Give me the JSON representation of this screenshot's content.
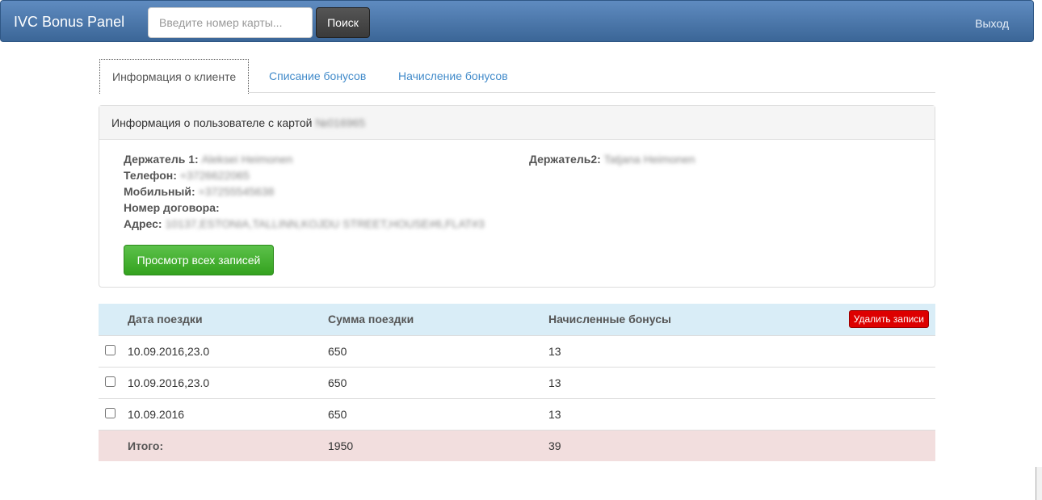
{
  "navbar": {
    "brand": "IVC Bonus Panel",
    "search_placeholder": "Введите номер карты...",
    "search_button": "Поиск",
    "logout": "Выход"
  },
  "tabs": [
    {
      "label": "Информация о клиенте",
      "active": true
    },
    {
      "label": "Списание бонусов"
    },
    {
      "label": "Начисление бонусов"
    }
  ],
  "panel": {
    "heading": "Информация о пользователе с картой",
    "card_number": "№016965",
    "holder1_label": "Держатель 1:",
    "holder1": "Aleksei Heimonen",
    "phone_label": "Телефон:",
    "phone": "+3726622065",
    "mobile_label": "Мобильный:",
    "mobile": "+37255545638",
    "contract_label": "Номер договора:",
    "address_label": "Адрес:",
    "address": "10137,ESTONIA,TALLINN,KOJDU STREET,HOUSE#6,FLAT#3",
    "holder2_label": "Держатель2:",
    "holder2": "Tatjana Heimonen",
    "view_all_button": "Просмотр всех записей"
  },
  "table": {
    "headers": [
      "Дата поездки",
      "Сумма поездки",
      "Начисленные бонусы"
    ],
    "delete_button": "Удалить записи",
    "rows": [
      {
        "date": "10.09.2016,23.0",
        "sum": "650",
        "bonus": "13"
      },
      {
        "date": "10.09.2016,23.0",
        "sum": "650",
        "bonus": "13"
      },
      {
        "date": "10.09.2016",
        "sum": "650",
        "bonus": "13"
      }
    ],
    "total": {
      "label": "Итого:",
      "sum": "1950",
      "bonus": "39"
    }
  }
}
